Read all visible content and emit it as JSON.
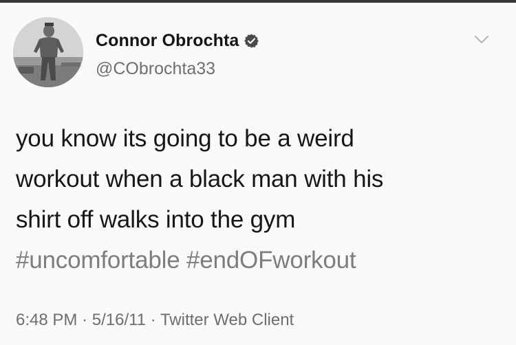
{
  "tweet": {
    "author": {
      "display_name": "Connor Obrochta",
      "handle": "@CObrochta33",
      "verified": true,
      "avatar_icon": "profile-photo"
    },
    "menu_icon": "chevron-down-icon",
    "text_lines": [
      "you know its going to be a weird",
      "workout when a black man with his",
      "shirt off walks into the gym"
    ],
    "hashtags": [
      "#uncomfortable",
      "#endOFworkout"
    ],
    "meta": {
      "time": "6:48 PM",
      "date": "5/16/11",
      "source": "Twitter Web Client",
      "separator": "·"
    }
  },
  "colors": {
    "background": "#fafafa",
    "name": "#141414",
    "handle": "#6f6f6f",
    "hashtag": "#7d7d7d",
    "meta": "#6d6d6d",
    "verified_badge": "#4a4a4a"
  }
}
